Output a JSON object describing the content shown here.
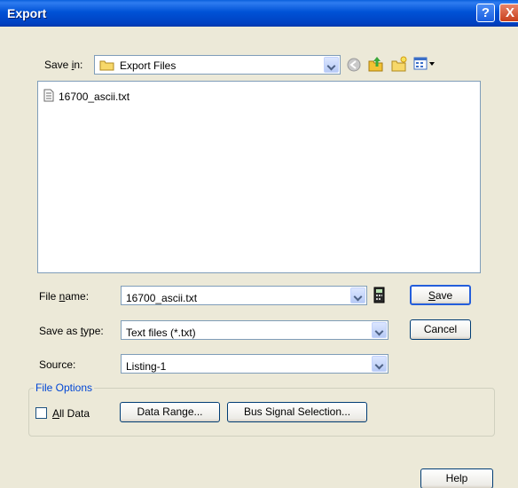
{
  "window": {
    "title": "Export",
    "help_glyph": "?",
    "close_glyph": "X"
  },
  "save_in": {
    "label_pre": "Save ",
    "label_accel": "i",
    "label_post": "n:",
    "value": "Export Files"
  },
  "files": [
    {
      "name": "16700_ascii.txt",
      "icon": "text-file-icon"
    }
  ],
  "file_name": {
    "label_pre": "File ",
    "label_accel": "n",
    "label_post": "ame:",
    "value": "16700_ascii.txt"
  },
  "save_as_type": {
    "label_pre": "Save as ",
    "label_accel": "t",
    "label_post": "ype:",
    "value": "Text files (*.txt)"
  },
  "source": {
    "label": "Source:",
    "value": "Listing-1"
  },
  "file_options": {
    "legend": "File Options",
    "all_data_accel": "A",
    "all_data_rest": "ll Data",
    "all_data_checked": false
  },
  "buttons": {
    "save_accel": "S",
    "save_rest": "ave",
    "cancel": "Cancel",
    "data_range": "Data Range...",
    "bus_signal": "Bus Signal Selection...",
    "help": "Help"
  }
}
